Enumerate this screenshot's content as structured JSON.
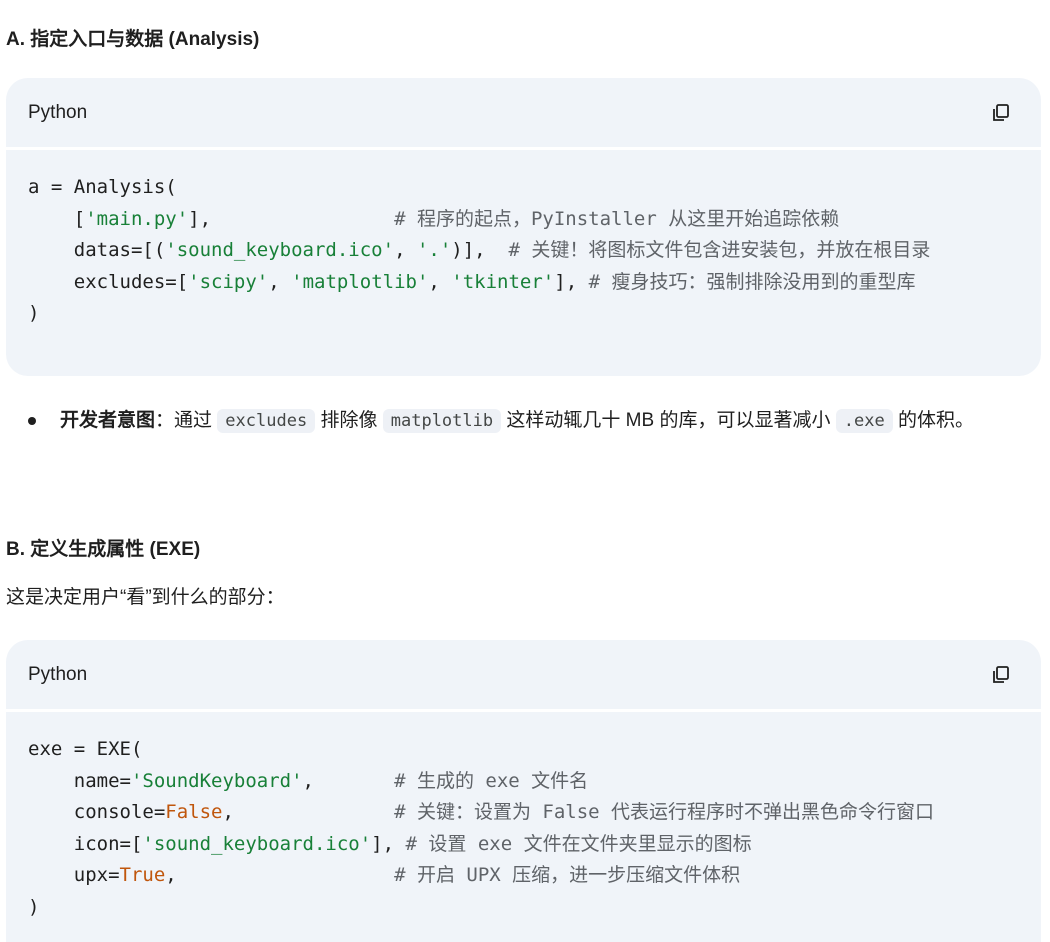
{
  "section_a": {
    "heading": "A. 指定入口与数据 (Analysis)",
    "code_block": {
      "language": "Python",
      "lines": [
        [
          {
            "t": "a = Analysis("
          }
        ],
        [
          {
            "t": "    ["
          },
          {
            "t": "'main.py'",
            "c": "s"
          },
          {
            "t": "],                "
          },
          {
            "t": "# 程序的起点，PyInstaller 从这里开始追踪依赖",
            "c": "c"
          }
        ],
        [
          {
            "t": "    datas=[("
          },
          {
            "t": "'sound_keyboard.ico'",
            "c": "s"
          },
          {
            "t": ", "
          },
          {
            "t": "'.'",
            "c": "s"
          },
          {
            "t": ")],  "
          },
          {
            "t": "# 关键！将图标文件包含进安装包，并放在根目录",
            "c": "c"
          }
        ],
        [
          {
            "t": "    excludes=["
          },
          {
            "t": "'scipy'",
            "c": "s"
          },
          {
            "t": ", "
          },
          {
            "t": "'matplotlib'",
            "c": "s"
          },
          {
            "t": ", "
          },
          {
            "t": "'tkinter'",
            "c": "s"
          },
          {
            "t": "], "
          },
          {
            "t": "# 瘦身技巧：强制排除没用到的重型库",
            "c": "c"
          }
        ],
        [
          {
            "t": ")"
          }
        ]
      ]
    },
    "bullet": {
      "bold": "开发者意图",
      "sep": "：通过 ",
      "code1": "excludes",
      "mid": " 排除像 ",
      "code2": "matplotlib",
      "after": " 这样动辄几十 MB 的库，可以显著减小 ",
      "code3": ".exe",
      "end": " 的体积。"
    }
  },
  "section_b": {
    "heading": "B. 定义生成属性 (EXE)",
    "intro": "这是决定用户“看”到什么的部分：",
    "code_block": {
      "language": "Python",
      "lines": [
        [
          {
            "t": "exe = EXE("
          }
        ],
        [
          {
            "t": "    name="
          },
          {
            "t": "'SoundKeyboard'",
            "c": "s"
          },
          {
            "t": ",       "
          },
          {
            "t": "# 生成的 exe 文件名",
            "c": "c"
          }
        ],
        [
          {
            "t": "    console="
          },
          {
            "t": "False",
            "c": "k"
          },
          {
            "t": ",              "
          },
          {
            "t": "# 关键：设置为 False 代表运行程序时不弹出黑色命令行窗口",
            "c": "c"
          }
        ],
        [
          {
            "t": "    icon=["
          },
          {
            "t": "'sound_keyboard.ico'",
            "c": "s"
          },
          {
            "t": "], "
          },
          {
            "t": "# 设置 exe 文件在文件夹里显示的图标",
            "c": "c"
          }
        ],
        [
          {
            "t": "    upx="
          },
          {
            "t": "True",
            "c": "k"
          },
          {
            "t": ",                   "
          },
          {
            "t": "# 开启 UPX 压缩，进一步压缩文件体积",
            "c": "c"
          }
        ],
        [
          {
            "t": ")"
          }
        ]
      ]
    }
  }
}
